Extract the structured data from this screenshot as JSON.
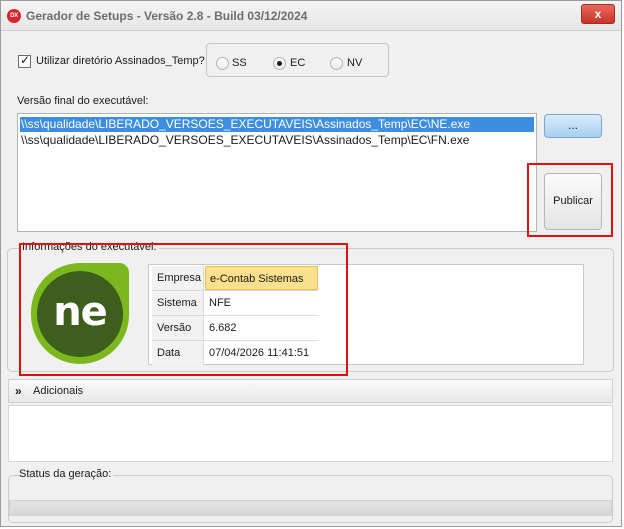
{
  "window": {
    "app_icon_text": "DX",
    "title": "Gerador de Setups - Versão 2.8 - Build 03/12/2024",
    "close_symbol": "x"
  },
  "options": {
    "use_signed_dir_label": "Utilizar diretório Assinados_Temp?",
    "use_signed_dir_checked": true,
    "radio_options": [
      {
        "label": "SS",
        "selected": false
      },
      {
        "label": "EC",
        "selected": true
      },
      {
        "label": "NV",
        "selected": false
      }
    ]
  },
  "final_version": {
    "label": "Versão final do executável:",
    "files": [
      {
        "path": "\\\\ss\\qualidade\\LIBERADO_VERSOES_EXECUTAVEIS\\Assinados_Temp\\EC\\NE.exe",
        "selected": true
      },
      {
        "path": "\\\\ss\\qualidade\\LIBERADO_VERSOES_EXECUTAVEIS\\Assinados_Temp\\EC\\FN.exe",
        "selected": false
      }
    ],
    "browse_label": "...",
    "publish_label": "Publicar"
  },
  "exe_info": {
    "title": "Informações do executável:",
    "logo_text": "ne",
    "rows": [
      {
        "key": "Empresa",
        "value": "e-Contab Sistemas",
        "highlighted": true
      },
      {
        "key": "Sistema",
        "value": "NFE",
        "highlighted": false
      },
      {
        "key": "Versão",
        "value": "6.682",
        "highlighted": false
      },
      {
        "key": "Data",
        "value": "07/04/2026 11:41:51",
        "highlighted": false
      }
    ]
  },
  "additional": {
    "expand_icon": "»",
    "label": "Adicionais"
  },
  "status": {
    "label": "Status da geração:"
  },
  "colors": {
    "selection": "#3d8ee0",
    "annotation_red": "#e01010",
    "logo_green": "#7cb81d",
    "logo_dark": "#3d5e1c",
    "highlight_cell": "#fbe08d"
  }
}
